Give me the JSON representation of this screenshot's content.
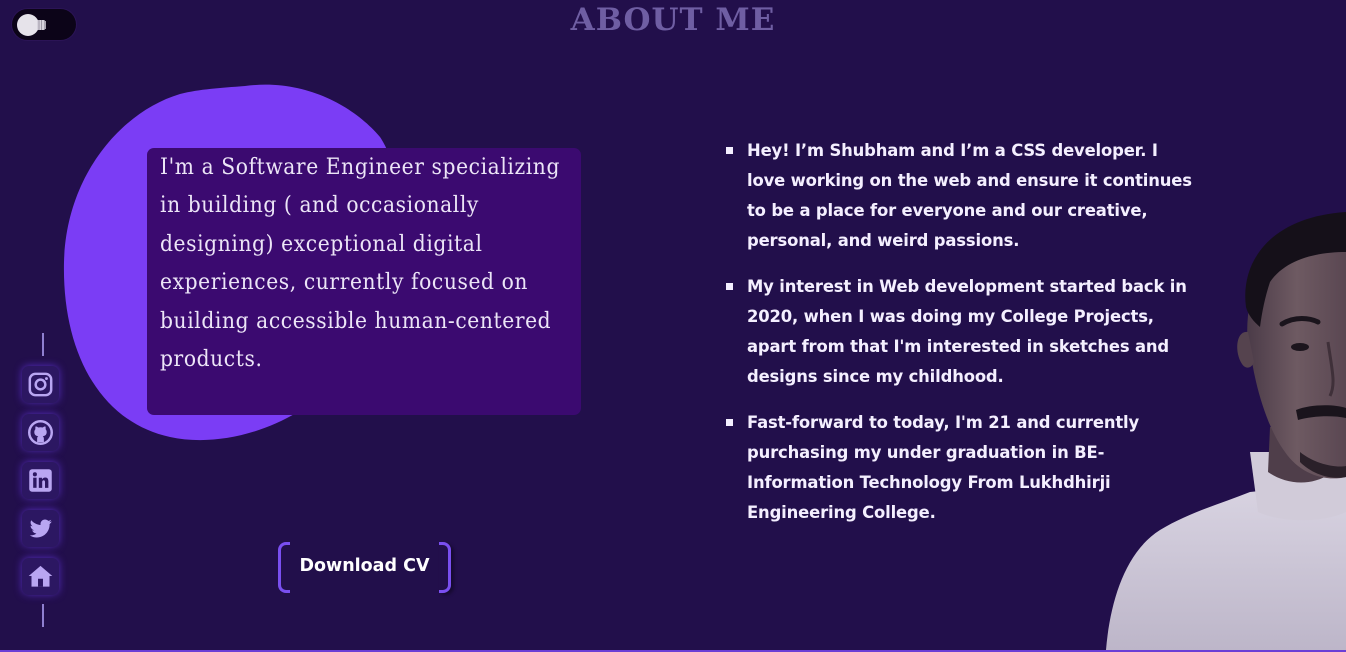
{
  "header": {
    "title": "ABOUT ME",
    "theme_toggle_icon": "lightbulb-icon"
  },
  "intro": {
    "text": "I'm a Software Engineer specializing in building ( and occasionally designing) exceptional digital experiences, currently focused on building accessible human-centered products."
  },
  "download": {
    "label": "Download CV"
  },
  "social": {
    "items": [
      {
        "name": "instagram",
        "icon": "instagram-icon"
      },
      {
        "name": "github",
        "icon": "github-icon"
      },
      {
        "name": "linkedin",
        "icon": "linkedin-icon"
      },
      {
        "name": "twitter",
        "icon": "twitter-icon"
      },
      {
        "name": "home",
        "icon": "home-icon"
      }
    ]
  },
  "about": {
    "points": [
      "Hey! I’m Shubham and I’m a CSS developer. I love working on the web and ensure it continues to be a place for everyone and our creative, personal, and weird passions.",
      "My interest in Web development started back in 2020, when I was doing my College Projects, apart from that I'm interested in sketches and designs since my childhood.",
      "Fast-forward to today, I'm 21 and currently purchasing my under graduation in BE-Information Technology From Lukhdhirji Engineering College."
    ]
  },
  "colors": {
    "background": "#220f4b",
    "accent": "#7a4ff0",
    "blob": "#7b3df5",
    "card": "#3b0a70",
    "title": "#6f5ea3"
  }
}
